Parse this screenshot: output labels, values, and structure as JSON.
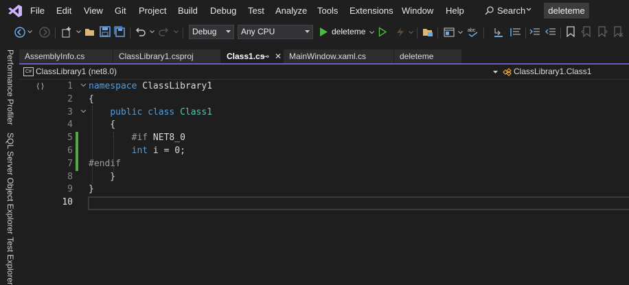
{
  "menu": {
    "items": [
      "File",
      "Edit",
      "View",
      "Git",
      "Project",
      "Build",
      "Debug",
      "Test",
      "Analyze",
      "Tools",
      "Extensions",
      "Window",
      "Help"
    ],
    "search_label": "Search",
    "solution_name": "deleteme"
  },
  "toolbar": {
    "config": "Debug",
    "platform": "Any CPU",
    "run_target": "deleteme"
  },
  "side_panels": [
    "Performance Profiler",
    "SQL Server Object Explorer",
    "Test Explorer"
  ],
  "tabs": [
    {
      "label": "AssemblyInfo.cs"
    },
    {
      "label": "ClassLibrary1.csproj"
    },
    {
      "label": "Class1.cs",
      "active": true,
      "pinned_glyph": "⊸",
      "close_glyph": "✕"
    },
    {
      "label": "MainWindow.xaml.cs"
    },
    {
      "label": "deleteme"
    }
  ],
  "navbar": {
    "project": "ClassLibrary1 (net8.0)",
    "member": "ClassLibrary1.Class1"
  },
  "editor": {
    "marker": "⟨⟩",
    "current_line": 10,
    "lines": [
      {
        "n": "1",
        "tokens": [
          {
            "t": "namespace",
            "c": "kw"
          },
          {
            "t": " ClassLibrary1"
          }
        ]
      },
      {
        "n": "2",
        "tokens": [
          {
            "t": "{"
          }
        ]
      },
      {
        "n": "3",
        "tokens": [
          {
            "t": "    "
          },
          {
            "t": "public",
            "c": "kw"
          },
          {
            "t": " "
          },
          {
            "t": "class",
            "c": "kw"
          },
          {
            "t": " "
          },
          {
            "t": "Class1",
            "c": "ty"
          }
        ]
      },
      {
        "n": "4",
        "tokens": [
          {
            "t": "    {"
          }
        ]
      },
      {
        "n": "5",
        "tokens": [
          {
            "t": "        "
          },
          {
            "t": "#if",
            "c": "pp"
          },
          {
            "t": " NET8_0"
          }
        ]
      },
      {
        "n": "6",
        "tokens": [
          {
            "t": "        "
          },
          {
            "t": "int",
            "c": "kw"
          },
          {
            "t": " i = 0;"
          }
        ]
      },
      {
        "n": "7",
        "tokens": [
          {
            "t": "#endif",
            "c": "pp"
          }
        ]
      },
      {
        "n": "8",
        "tokens": [
          {
            "t": "    }"
          }
        ]
      },
      {
        "n": "9",
        "tokens": [
          {
            "t": "}"
          }
        ]
      },
      {
        "n": "10",
        "tokens": []
      }
    ]
  }
}
